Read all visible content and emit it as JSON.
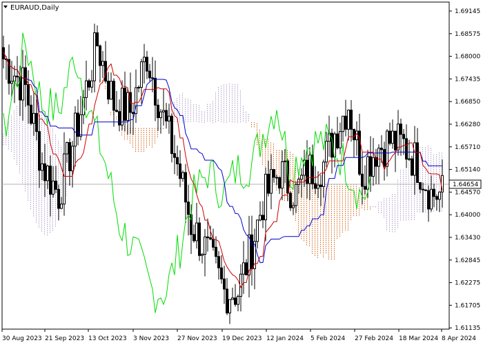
{
  "window": {
    "symbol_title": "EURAUD,Daily",
    "current_price_label": "1.64654"
  },
  "colors": {
    "background": "#ffffff",
    "candle": "#000000",
    "tenkan": "#cc0000",
    "kijun": "#0000cc",
    "chikou": "#00dd00",
    "kumo_bear": "#d2691e",
    "kumo_bull": "#b0a0c8",
    "price_line": "#b0b0b0"
  },
  "chart_data": {
    "type": "candlestick",
    "indicator": "ichimoku",
    "y_axis": {
      "min": 1.608,
      "max": 1.695,
      "ticks": [
        "1.69145",
        "1.68575",
        "1.68000",
        "1.67435",
        "1.66850",
        "1.66280",
        "1.65710",
        "1.65140",
        "1.64570",
        "1.64000",
        "1.63430",
        "1.62845",
        "1.62275",
        "1.61705",
        "1.61135"
      ]
    },
    "x_axis": {
      "ticks": [
        "30 Aug 2023",
        "21 Sep 2023",
        "13 Oct 2023",
        "3 Nov 2023",
        "27 Nov 2023",
        "19 Dec 2023",
        "12 Jan 2024",
        "5 Feb 2024",
        "27 Feb 2024",
        "18 Mar 2024",
        "8 Apr 2024"
      ]
    },
    "current_price": 1.64654,
    "price_path": [
      {
        "i": 0,
        "p": 1.68
      },
      {
        "i": 8,
        "p": 1.672
      },
      {
        "i": 14,
        "p": 1.652
      },
      {
        "i": 20,
        "p": 1.644
      },
      {
        "i": 26,
        "p": 1.66
      },
      {
        "i": 34,
        "p": 1.684
      },
      {
        "i": 40,
        "p": 1.668
      },
      {
        "i": 46,
        "p": 1.666
      },
      {
        "i": 52,
        "p": 1.681
      },
      {
        "i": 58,
        "p": 1.664
      },
      {
        "i": 63,
        "p": 1.652
      },
      {
        "i": 68,
        "p": 1.636
      },
      {
        "i": 74,
        "p": 1.628
      },
      {
        "i": 80,
        "p": 1.618
      },
      {
        "i": 85,
        "p": 1.618
      },
      {
        "i": 90,
        "p": 1.63
      },
      {
        "i": 94,
        "p": 1.642
      },
      {
        "i": 100,
        "p": 1.65
      },
      {
        "i": 106,
        "p": 1.644
      },
      {
        "i": 110,
        "p": 1.65
      },
      {
        "i": 116,
        "p": 1.652
      },
      {
        "i": 120,
        "p": 1.66
      },
      {
        "i": 125,
        "p": 1.668
      },
      {
        "i": 130,
        "p": 1.65
      },
      {
        "i": 135,
        "p": 1.656
      },
      {
        "i": 140,
        "p": 1.658
      },
      {
        "i": 145,
        "p": 1.657
      },
      {
        "i": 150,
        "p": 1.652
      },
      {
        "i": 155,
        "p": 1.644
      }
    ]
  }
}
